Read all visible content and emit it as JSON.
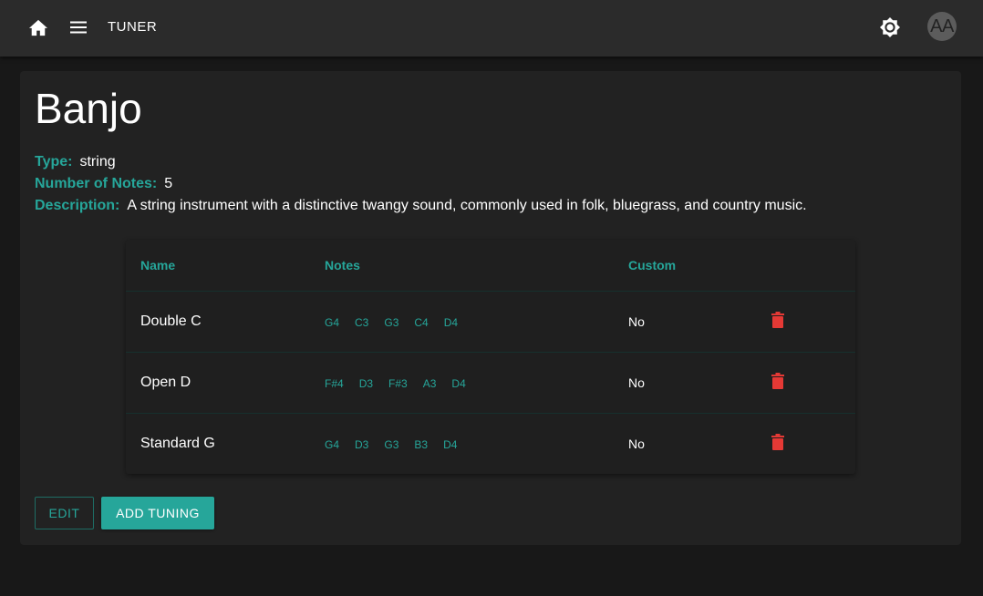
{
  "app": {
    "title": "TUNER",
    "avatar_initials": "AA",
    "accent_color": "#26a69a",
    "delete_color": "#e53935"
  },
  "instrument": {
    "name": "Banjo",
    "type_label": "Type:",
    "type_value": "string",
    "count_label": "Number of Notes:",
    "count_value": "5",
    "description_label": "Description:",
    "description_value": "A string instrument with a distinctive twangy sound, commonly used in folk, bluegrass, and country music."
  },
  "table": {
    "headers": {
      "name": "Name",
      "notes": "Notes",
      "custom": "Custom"
    },
    "rows": [
      {
        "name": "Double C",
        "notes": [
          "G4",
          "C3",
          "G3",
          "C4",
          "D4"
        ],
        "custom": "No"
      },
      {
        "name": "Open D",
        "notes": [
          "F#4",
          "D3",
          "F#3",
          "A3",
          "D4"
        ],
        "custom": "No"
      },
      {
        "name": "Standard G",
        "notes": [
          "G4",
          "D3",
          "G3",
          "B3",
          "D4"
        ],
        "custom": "No"
      }
    ]
  },
  "actions": {
    "edit_label": "EDIT",
    "add_label": "ADD TUNING"
  },
  "icons": {
    "home": "home-icon",
    "menu": "menu-icon",
    "theme": "brightness-icon",
    "delete": "trash-icon"
  }
}
